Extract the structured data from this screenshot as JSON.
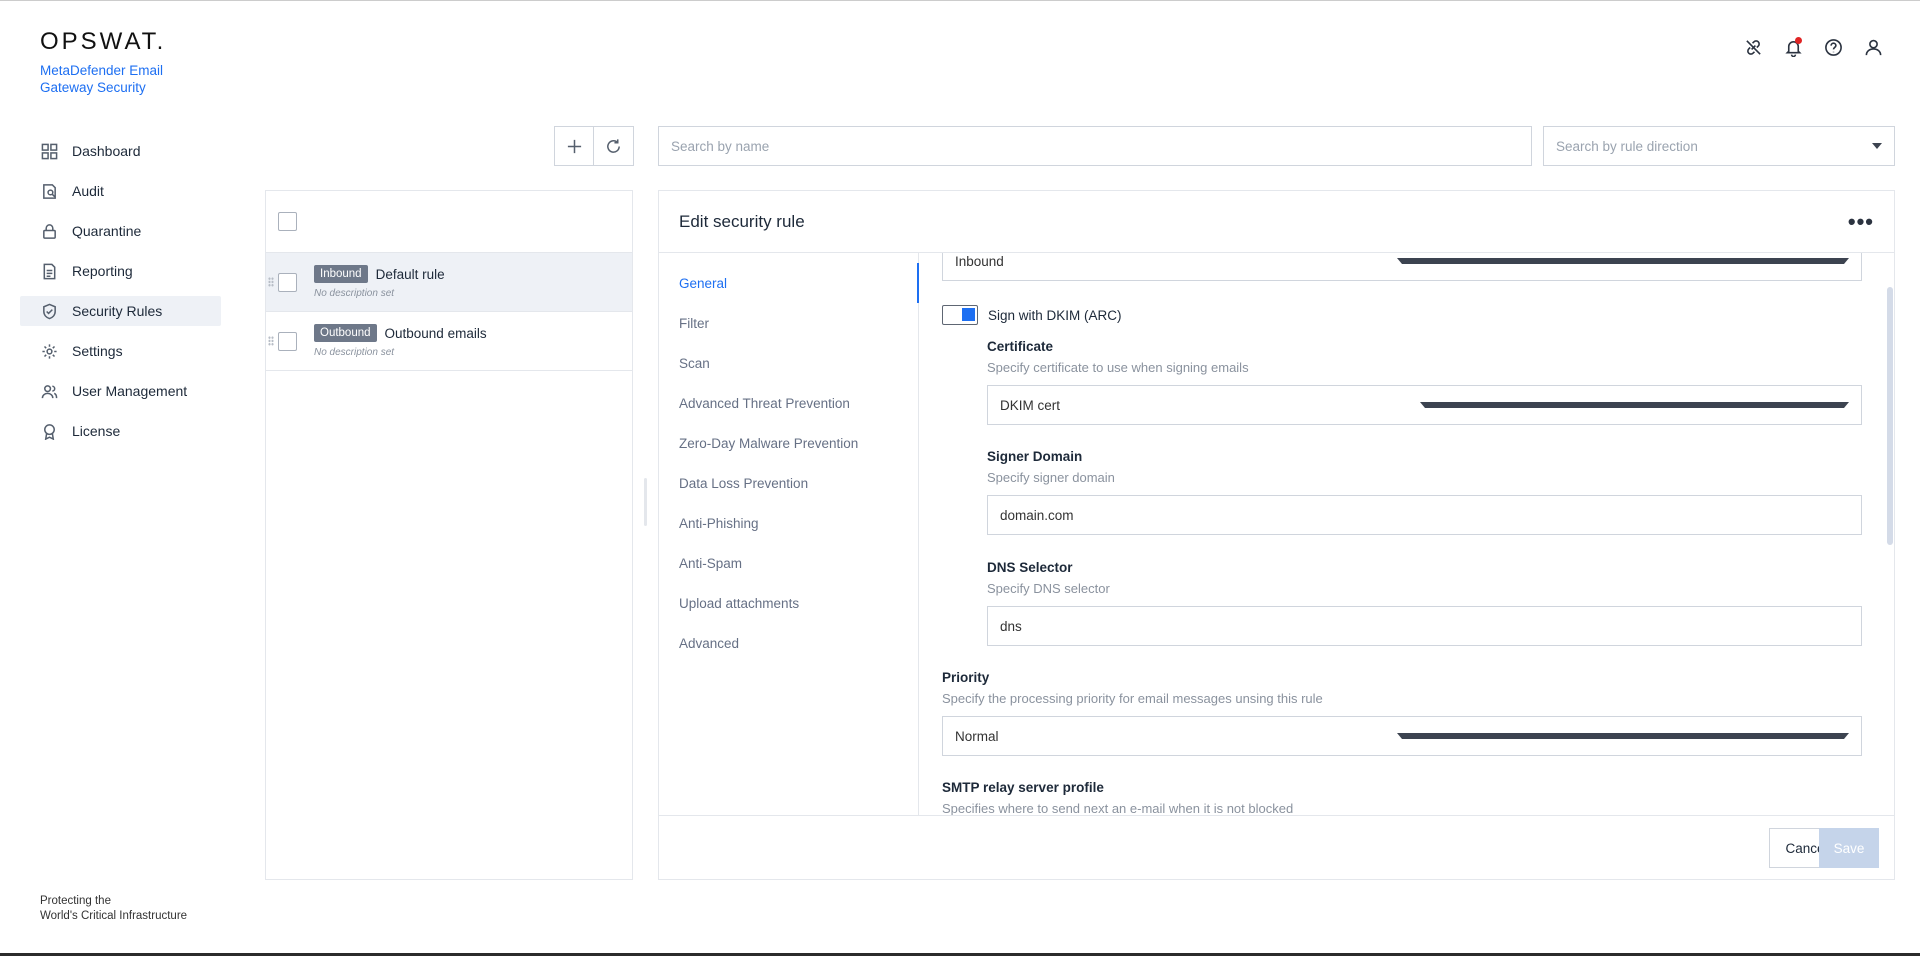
{
  "brand": {
    "logo": "OPSWAT.",
    "product": "MetaDefender Email Gateway Security"
  },
  "nav": [
    {
      "label": "Dashboard",
      "icon": "grid-icon"
    },
    {
      "label": "Audit",
      "icon": "audit-icon"
    },
    {
      "label": "Quarantine",
      "icon": "lock-icon"
    },
    {
      "label": "Reporting",
      "icon": "document-icon"
    },
    {
      "label": "Security Rules",
      "icon": "shield-check-icon",
      "active": true
    },
    {
      "label": "Settings",
      "icon": "gear-icon"
    },
    {
      "label": "User Management",
      "icon": "users-icon"
    },
    {
      "label": "License",
      "icon": "badge-icon"
    }
  ],
  "footer": {
    "line1": "Protecting the",
    "line2": "World's Critical Infrastructure"
  },
  "header_icons": [
    "link-icon",
    "bell-icon",
    "help-icon",
    "user-icon"
  ],
  "toolbar": {
    "search_placeholder": "Search by name",
    "direction_placeholder": "Search by rule direction"
  },
  "rules": [
    {
      "badge": "Inbound",
      "name": "Default rule",
      "desc": "No description set"
    },
    {
      "badge": "Outbound",
      "name": "Outbound emails",
      "desc": "No description set"
    }
  ],
  "edit": {
    "title": "Edit security rule",
    "tabs": [
      "General",
      "Filter",
      "Scan",
      "Advanced Threat Prevention",
      "Zero-Day Malware Prevention",
      "Data Loss Prevention",
      "Anti-Phishing",
      "Anti-Spam",
      "Upload attachments",
      "Advanced"
    ],
    "direction_value": "Inbound",
    "dkim_toggle_label": "Sign with DKIM (ARC)",
    "certificate": {
      "label": "Certificate",
      "help": "Specify certificate to use when signing emails",
      "value": "DKIM cert"
    },
    "signer_domain": {
      "label": "Signer Domain",
      "help": "Specify signer domain",
      "value": "domain.com"
    },
    "dns_selector": {
      "label": "DNS Selector",
      "help": "Specify DNS selector",
      "value": "dns"
    },
    "priority": {
      "label": "Priority",
      "help": "Specify the processing priority for email messages unsing this rule",
      "value": "Normal"
    },
    "smtp": {
      "label": "SMTP relay server profile",
      "help": "Specifies where to send next an e-mail when it is not blocked"
    },
    "cancel_label": "Cancel",
    "save_label": "Save"
  },
  "colors": {
    "accent": "#1d6ff2",
    "badge": "#6e7889",
    "notification": "#e02424"
  }
}
